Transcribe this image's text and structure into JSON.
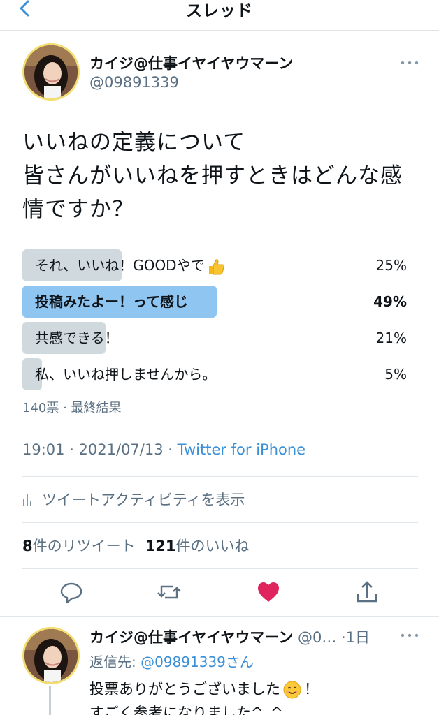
{
  "header": {
    "title": "スレッド"
  },
  "tweet": {
    "author_name": "カイジ@仕事イヤイヤウマーン",
    "author_handle": "@09891339",
    "text_line1": "いいねの定義について",
    "text_line2": "皆さんがいいねを押すときはどんな感",
    "text_line3": "情ですか？",
    "poll": {
      "options": [
        {
          "label": "それ、いいね！GOODやで",
          "percent_label": "25%",
          "percent": 25,
          "winner": false
        },
        {
          "label": "投稿みたよー！って感じ",
          "percent_label": "49%",
          "percent": 49,
          "winner": true
        },
        {
          "label": "共感できる！",
          "percent_label": "21%",
          "percent": 21,
          "winner": false
        },
        {
          "label": "私、いいね押しませんから。",
          "percent_label": "5%",
          "percent": 5,
          "winner": false
        }
      ],
      "meta": "140票 · 最終結果"
    },
    "timestamp": "19:01 · 2021/07/13 · ",
    "source": "Twitter for iPhone",
    "activity_label": "ツイートアクティビティを表示",
    "retweet_count": "8",
    "retweet_label": "件のリツイート",
    "like_count": "121",
    "like_label": "件のいいね"
  },
  "reply": {
    "author_name": "カイジ@仕事イヤイヤウマーン",
    "handle_time": " @0… ·1日",
    "reply_to_prefix": "返信先: ",
    "reply_to_handle": "@09891339さん",
    "text_line1a": "投票ありがとうございました",
    "text_line1b": "！",
    "text_line2": "すごく参考になりました^_^"
  },
  "colors": {
    "poll_bar": "#cfd9de",
    "poll_bar_winner": "#8ec5f1",
    "link": "#3b8fd6",
    "like_heart": "#e0245e",
    "muted": "#5b7083"
  },
  "icons": [
    "chevron-left-icon",
    "more-icon",
    "thumbs-up-emoji",
    "bar-chart-icon",
    "reply-icon",
    "retweet-icon",
    "heart-icon",
    "share-icon",
    "smile-emoji"
  ]
}
